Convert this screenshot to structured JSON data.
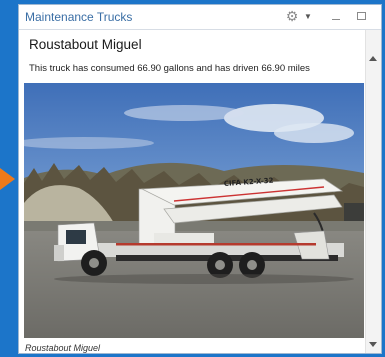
{
  "window": {
    "title": "Maintenance Trucks"
  },
  "record": {
    "name": "Roustabout Miguel",
    "description": "This truck has consumed 66.90 gallons and has driven 66.90 miles",
    "caption": "Roustabout Miguel",
    "truck_lettering": "CIFA K2-X-32"
  },
  "colors": {
    "page_background": "#1c75c9",
    "accent_arrow": "#ef7a1a",
    "title_text": "#3a6ea5"
  },
  "icons": {
    "settings": "gear-icon",
    "menu": "chevron-down-icon",
    "minimize": "minimize-icon",
    "maximize": "maximize-icon"
  }
}
